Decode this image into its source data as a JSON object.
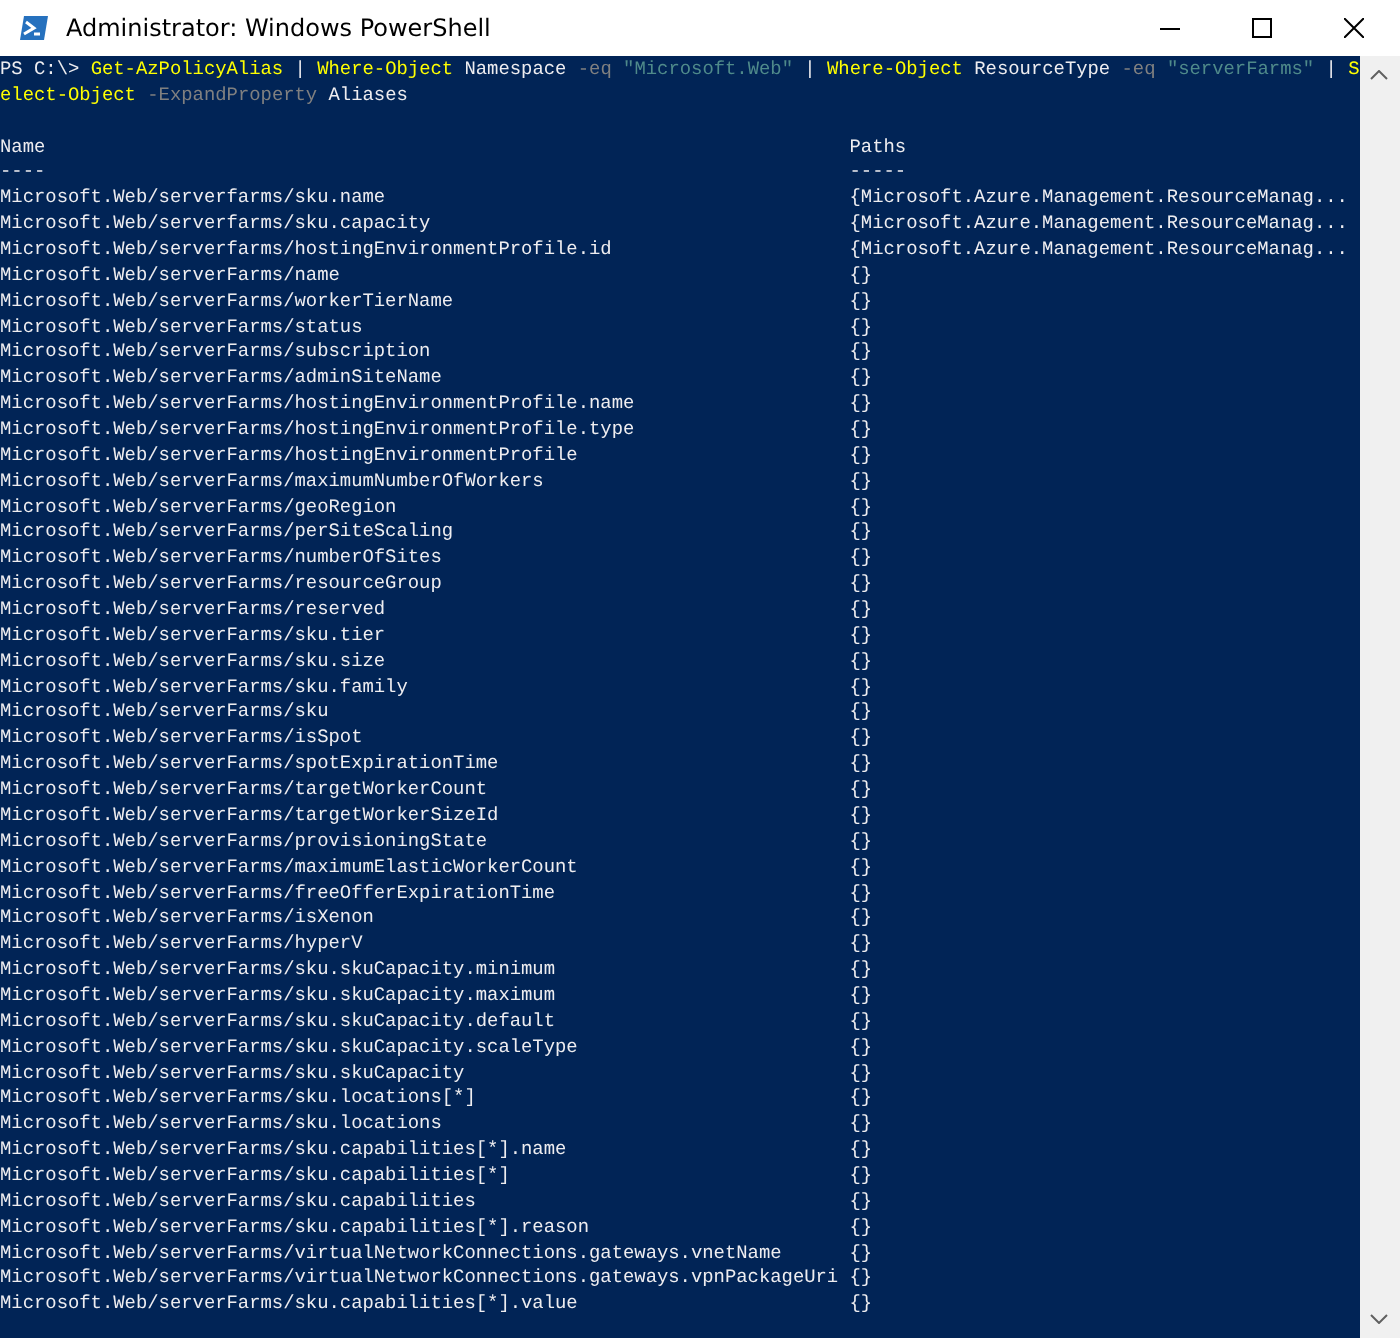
{
  "window": {
    "title": "Administrator: Windows PowerShell"
  },
  "prompt_lines": [
    [
      {
        "kind": "plain",
        "text": "PS C:\\> "
      },
      {
        "kind": "command",
        "text": "Get-AzPolicyAlias"
      },
      {
        "kind": "plain",
        "text": " | "
      },
      {
        "kind": "command",
        "text": "Where-Object"
      },
      {
        "kind": "plain",
        "text": " Namespace "
      },
      {
        "kind": "parameter",
        "text": "-eq"
      },
      {
        "kind": "space"
      },
      {
        "kind": "string",
        "text": "\"Microsoft.Web\""
      },
      {
        "kind": "plain",
        "text": " | "
      },
      {
        "kind": "command",
        "text": "Where-Object"
      },
      {
        "kind": "plain",
        "text": " ResourceType "
      },
      {
        "kind": "parameter",
        "text": "-eq"
      },
      {
        "kind": "space"
      },
      {
        "kind": "string",
        "text": "\"serverFarms\""
      },
      {
        "kind": "plain",
        "text": " | "
      },
      {
        "kind": "command",
        "text": "S"
      }
    ],
    [
      {
        "kind": "command",
        "text": "elect-Object"
      },
      {
        "kind": "space"
      },
      {
        "kind": "parameter",
        "text": "-ExpandProperty"
      },
      {
        "kind": "plain",
        "text": " Aliases"
      }
    ]
  ],
  "table": {
    "columns": [
      {
        "header": "Name",
        "underline": "----"
      },
      {
        "header": "Paths",
        "underline": "-----"
      }
    ],
    "rows": [
      {
        "name": "Microsoft.Web/serverfarms/sku.name",
        "paths": "{Microsoft.Azure.Management.ResourceManag..."
      },
      {
        "name": "Microsoft.Web/serverfarms/sku.capacity",
        "paths": "{Microsoft.Azure.Management.ResourceManag..."
      },
      {
        "name": "Microsoft.Web/serverfarms/hostingEnvironmentProfile.id",
        "paths": "{Microsoft.Azure.Management.ResourceManag..."
      },
      {
        "name": "Microsoft.Web/serverFarms/name",
        "paths": "{}"
      },
      {
        "name": "Microsoft.Web/serverFarms/workerTierName",
        "paths": "{}"
      },
      {
        "name": "Microsoft.Web/serverFarms/status",
        "paths": "{}"
      },
      {
        "name": "Microsoft.Web/serverFarms/subscription",
        "paths": "{}"
      },
      {
        "name": "Microsoft.Web/serverFarms/adminSiteName",
        "paths": "{}"
      },
      {
        "name": "Microsoft.Web/serverFarms/hostingEnvironmentProfile.name",
        "paths": "{}"
      },
      {
        "name": "Microsoft.Web/serverFarms/hostingEnvironmentProfile.type",
        "paths": "{}"
      },
      {
        "name": "Microsoft.Web/serverFarms/hostingEnvironmentProfile",
        "paths": "{}"
      },
      {
        "name": "Microsoft.Web/serverFarms/maximumNumberOfWorkers",
        "paths": "{}"
      },
      {
        "name": "Microsoft.Web/serverFarms/geoRegion",
        "paths": "{}"
      },
      {
        "name": "Microsoft.Web/serverFarms/perSiteScaling",
        "paths": "{}"
      },
      {
        "name": "Microsoft.Web/serverFarms/numberOfSites",
        "paths": "{}"
      },
      {
        "name": "Microsoft.Web/serverFarms/resourceGroup",
        "paths": "{}"
      },
      {
        "name": "Microsoft.Web/serverFarms/reserved",
        "paths": "{}"
      },
      {
        "name": "Microsoft.Web/serverFarms/sku.tier",
        "paths": "{}"
      },
      {
        "name": "Microsoft.Web/serverFarms/sku.size",
        "paths": "{}"
      },
      {
        "name": "Microsoft.Web/serverFarms/sku.family",
        "paths": "{}"
      },
      {
        "name": "Microsoft.Web/serverFarms/sku",
        "paths": "{}"
      },
      {
        "name": "Microsoft.Web/serverFarms/isSpot",
        "paths": "{}"
      },
      {
        "name": "Microsoft.Web/serverFarms/spotExpirationTime",
        "paths": "{}"
      },
      {
        "name": "Microsoft.Web/serverFarms/targetWorkerCount",
        "paths": "{}"
      },
      {
        "name": "Microsoft.Web/serverFarms/targetWorkerSizeId",
        "paths": "{}"
      },
      {
        "name": "Microsoft.Web/serverFarms/provisioningState",
        "paths": "{}"
      },
      {
        "name": "Microsoft.Web/serverFarms/maximumElasticWorkerCount",
        "paths": "{}"
      },
      {
        "name": "Microsoft.Web/serverFarms/freeOfferExpirationTime",
        "paths": "{}"
      },
      {
        "name": "Microsoft.Web/serverFarms/isXenon",
        "paths": "{}"
      },
      {
        "name": "Microsoft.Web/serverFarms/hyperV",
        "paths": "{}"
      },
      {
        "name": "Microsoft.Web/serverFarms/sku.skuCapacity.minimum",
        "paths": "{}"
      },
      {
        "name": "Microsoft.Web/serverFarms/sku.skuCapacity.maximum",
        "paths": "{}"
      },
      {
        "name": "Microsoft.Web/serverFarms/sku.skuCapacity.default",
        "paths": "{}"
      },
      {
        "name": "Microsoft.Web/serverFarms/sku.skuCapacity.scaleType",
        "paths": "{}"
      },
      {
        "name": "Microsoft.Web/serverFarms/sku.skuCapacity",
        "paths": "{}"
      },
      {
        "name": "Microsoft.Web/serverFarms/sku.locations[*]",
        "paths": "{}"
      },
      {
        "name": "Microsoft.Web/serverFarms/sku.locations",
        "paths": "{}"
      },
      {
        "name": "Microsoft.Web/serverFarms/sku.capabilities[*].name",
        "paths": "{}"
      },
      {
        "name": "Microsoft.Web/serverFarms/sku.capabilities[*]",
        "paths": "{}"
      },
      {
        "name": "Microsoft.Web/serverFarms/sku.capabilities",
        "paths": "{}"
      },
      {
        "name": "Microsoft.Web/serverFarms/sku.capabilities[*].reason",
        "paths": "{}"
      },
      {
        "name": "Microsoft.Web/serverFarms/virtualNetworkConnections.gateways.vnetName",
        "paths": "{}"
      },
      {
        "name": "Microsoft.Web/serverFarms/virtualNetworkConnections.gateways.vpnPackageUri",
        "paths": "{}"
      },
      {
        "name": "Microsoft.Web/serverFarms/sku.capabilities[*].value",
        "paths": "{}"
      }
    ]
  }
}
